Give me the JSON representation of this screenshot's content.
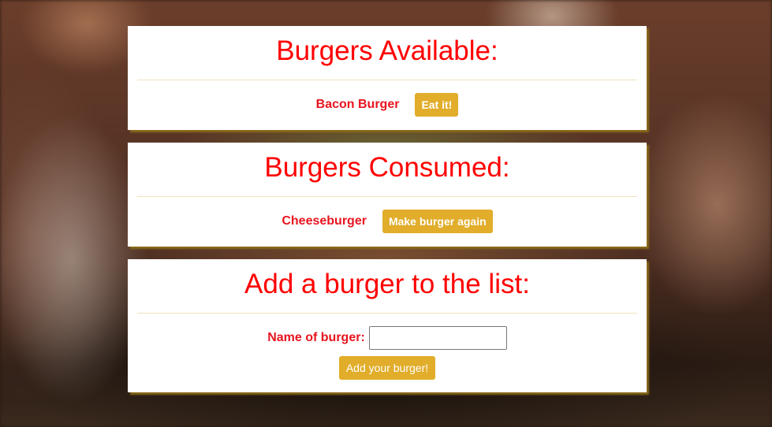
{
  "available": {
    "heading": "Burgers Available:",
    "item_name": "Bacon Burger",
    "button_label": "Eat it!"
  },
  "consumed": {
    "heading": "Burgers Consumed:",
    "item_name": "Cheeseburger",
    "button_label": "Make burger again"
  },
  "add_form": {
    "heading": "Add a burger to the list:",
    "field_label": "Name of burger:",
    "field_value": "",
    "button_label": "Add your burger!"
  },
  "colors": {
    "heading_red": "#ff0000",
    "button_gold": "#e1ad2a"
  }
}
